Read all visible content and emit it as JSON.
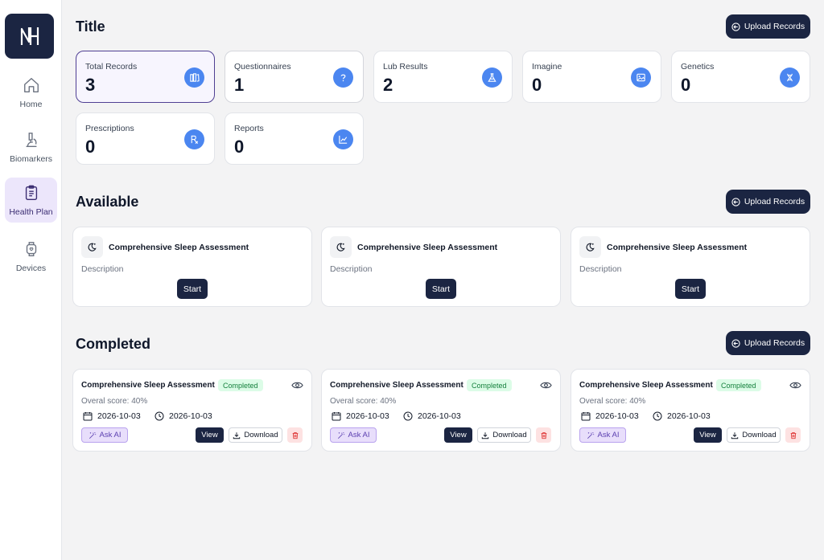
{
  "sidebar": {
    "logo_text": "NH",
    "items": [
      {
        "label": "Home",
        "icon": "home-icon"
      },
      {
        "label": "Biomarkers",
        "icon": "microscope-icon"
      },
      {
        "label": "Health Plan",
        "icon": "clipboard-icon",
        "active": true
      },
      {
        "label": "Devices",
        "icon": "watch-icon"
      }
    ]
  },
  "colors": {
    "primary": "#1b2542",
    "accent_blue": "#4b86f0",
    "active_nav": "#ece6fb",
    "success_bg": "#dcfce7",
    "success_text": "#15803d",
    "danger": "#dc2626"
  },
  "sections": {
    "title": "Title",
    "available": "Available",
    "completed": "Completed",
    "upload_label": "Upload Records"
  },
  "stats": [
    {
      "label": "Total Records",
      "value": "3",
      "icon": "books-icon"
    },
    {
      "label": "Questionnaires",
      "value": "1",
      "icon": "question-icon"
    },
    {
      "label": "Lub Results",
      "value": "2",
      "icon": "flask-icon"
    },
    {
      "label": "Imagine",
      "value": "0",
      "icon": "image-icon"
    },
    {
      "label": "Genetics",
      "value": "0",
      "icon": "dna-icon"
    },
    {
      "label": "Prescriptions",
      "value": "0",
      "icon": "rx-icon"
    },
    {
      "label": "Reports",
      "value": "0",
      "icon": "chart-line-icon"
    }
  ],
  "available": [
    {
      "title": "Comprehensive Sleep Assessment",
      "description": "Description",
      "start_label": "Start"
    },
    {
      "title": "Comprehensive Sleep Assessment",
      "description": "Description",
      "start_label": "Start"
    },
    {
      "title": "Comprehensive Sleep Assessment",
      "description": "Description",
      "start_label": "Start"
    }
  ],
  "completed": [
    {
      "title": "Comprehensive Sleep Assessment",
      "status": "Completed",
      "score": "Overal score: 40%",
      "date": "2026-10-03",
      "time": "2026-10-03",
      "ask_ai": "Ask AI",
      "view": "View",
      "download": "Download"
    },
    {
      "title": "Comprehensive Sleep Assessment",
      "status": "Completed",
      "score": "Overal score: 40%",
      "date": "2026-10-03",
      "time": "2026-10-03",
      "ask_ai": "Ask AI",
      "view": "View",
      "download": "Download"
    },
    {
      "title": "Comprehensive Sleep Assessment",
      "status": "Completed",
      "score": "Overal score: 40%",
      "date": "2026-10-03",
      "time": "2026-10-03",
      "ask_ai": "Ask AI",
      "view": "View",
      "download": "Download"
    }
  ]
}
